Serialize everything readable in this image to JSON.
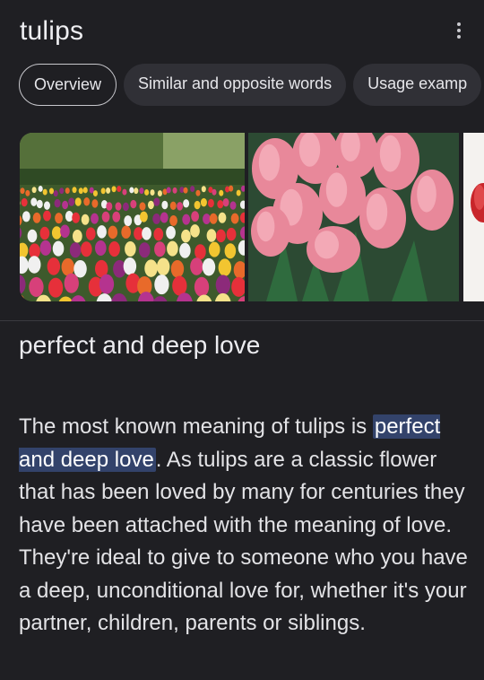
{
  "header": {
    "title": "tulips"
  },
  "chips": [
    {
      "label": "Overview",
      "active": true
    },
    {
      "label": "Similar and opposite words",
      "active": false
    },
    {
      "label": "Usage examp",
      "active": false
    }
  ],
  "images": [
    {
      "name": "tulip-field-photo"
    },
    {
      "name": "pink-tulips-photo"
    },
    {
      "name": "red-tulip-photo"
    }
  ],
  "answer": {
    "heading": "perfect and deep love",
    "text_before": "The most known meaning of tulips is ",
    "highlight": "perfect and deep love",
    "text_after": ". As tulips are a classic flower that has been loved by many for centuries they have been attached with the meaning of love. They're ideal to give to someone who you have a deep, unconditional love for, whether it's your partner, children, parents or siblings."
  },
  "colors": {
    "background": "#1f1f23",
    "chip": "#303036",
    "highlight": "#33436b"
  }
}
